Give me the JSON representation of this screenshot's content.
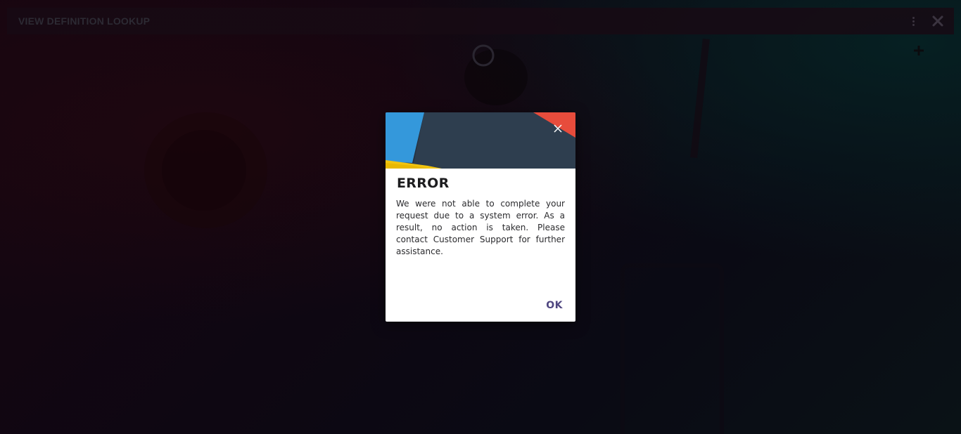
{
  "window": {
    "title": "VIEW DEFINITION LOOKUP",
    "menu_icon": "more-vertical-icon",
    "close_icon": "close-icon",
    "add_icon": "plus-icon"
  },
  "dialog": {
    "title": "ERROR",
    "message": "We were not able to complete your request due to a system error. As a result, no action is taken. Please contact Customer Support for further assistance.",
    "ok_label": "OK",
    "close_icon": "close-icon"
  },
  "colors": {
    "header_dark": "#2e3e4f",
    "accent_blue": "#3498db",
    "accent_red": "#e74c3c",
    "accent_yellow": "#f1c40f",
    "ok_text": "#4f4680"
  }
}
